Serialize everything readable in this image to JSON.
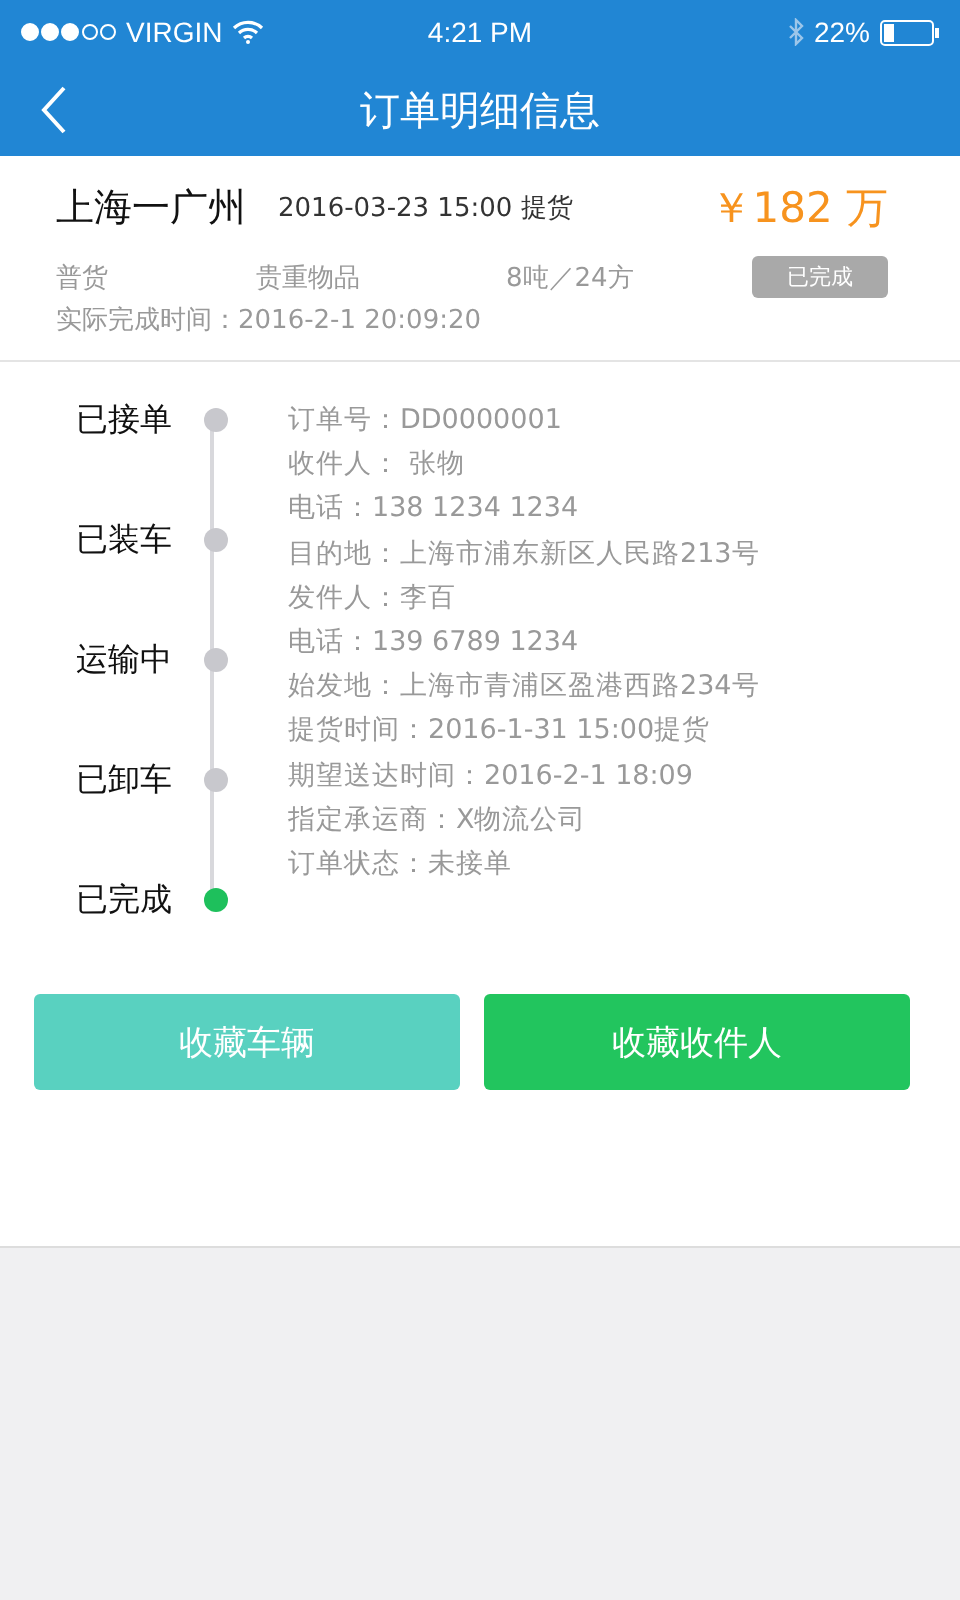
{
  "status_bar": {
    "carrier": "VIRGIN",
    "time": "4:21 PM",
    "battery": "22%"
  },
  "header": {
    "title": "订单明细信息"
  },
  "summary": {
    "route": "上海一广州",
    "pickup": "2016-03-23  15:00 提货",
    "price": "￥182 万",
    "cargo_type": "普货",
    "category": "贵重物品",
    "weight": "8吨／24方",
    "state_badge": "已完成",
    "finish_time": "实际完成时间：2016-2-1   20:09:20"
  },
  "steps": [
    {
      "label": "已接单",
      "current": false
    },
    {
      "label": "已装车",
      "current": false
    },
    {
      "label": "运输中",
      "current": false
    },
    {
      "label": "已卸车",
      "current": false
    },
    {
      "label": "已完成",
      "current": true
    }
  ],
  "details": [
    "订单号：DD0000001",
    "收件人： 张物",
    "电话：138 1234 1234",
    "目的地：上海市浦东新区人民路213号",
    "发件人：李百",
    "电话：139 6789 1234",
    "始发地：上海市青浦区盈港西路234号",
    "提货时间：2016-1-31 15:00提货",
    "期望送达时间：2016-2-1 18:09",
    "指定承运商：X物流公司",
    "订单状态：未接单"
  ],
  "buttons": [
    {
      "label": "收藏车辆",
      "kind": "secondary"
    },
    {
      "label": "收藏收件人",
      "kind": "primary"
    }
  ]
}
